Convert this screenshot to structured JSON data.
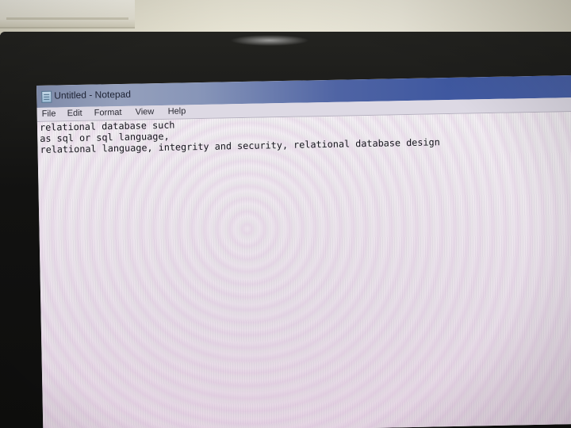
{
  "window": {
    "title": "Untitled - Notepad",
    "icon": "notepad-icon"
  },
  "menu": {
    "items": [
      "File",
      "Edit",
      "Format",
      "View",
      "Help"
    ]
  },
  "editor": {
    "lines": [
      "relational database such",
      "as sql or sql language,",
      "relational language, integrity and security, relational database design"
    ]
  }
}
